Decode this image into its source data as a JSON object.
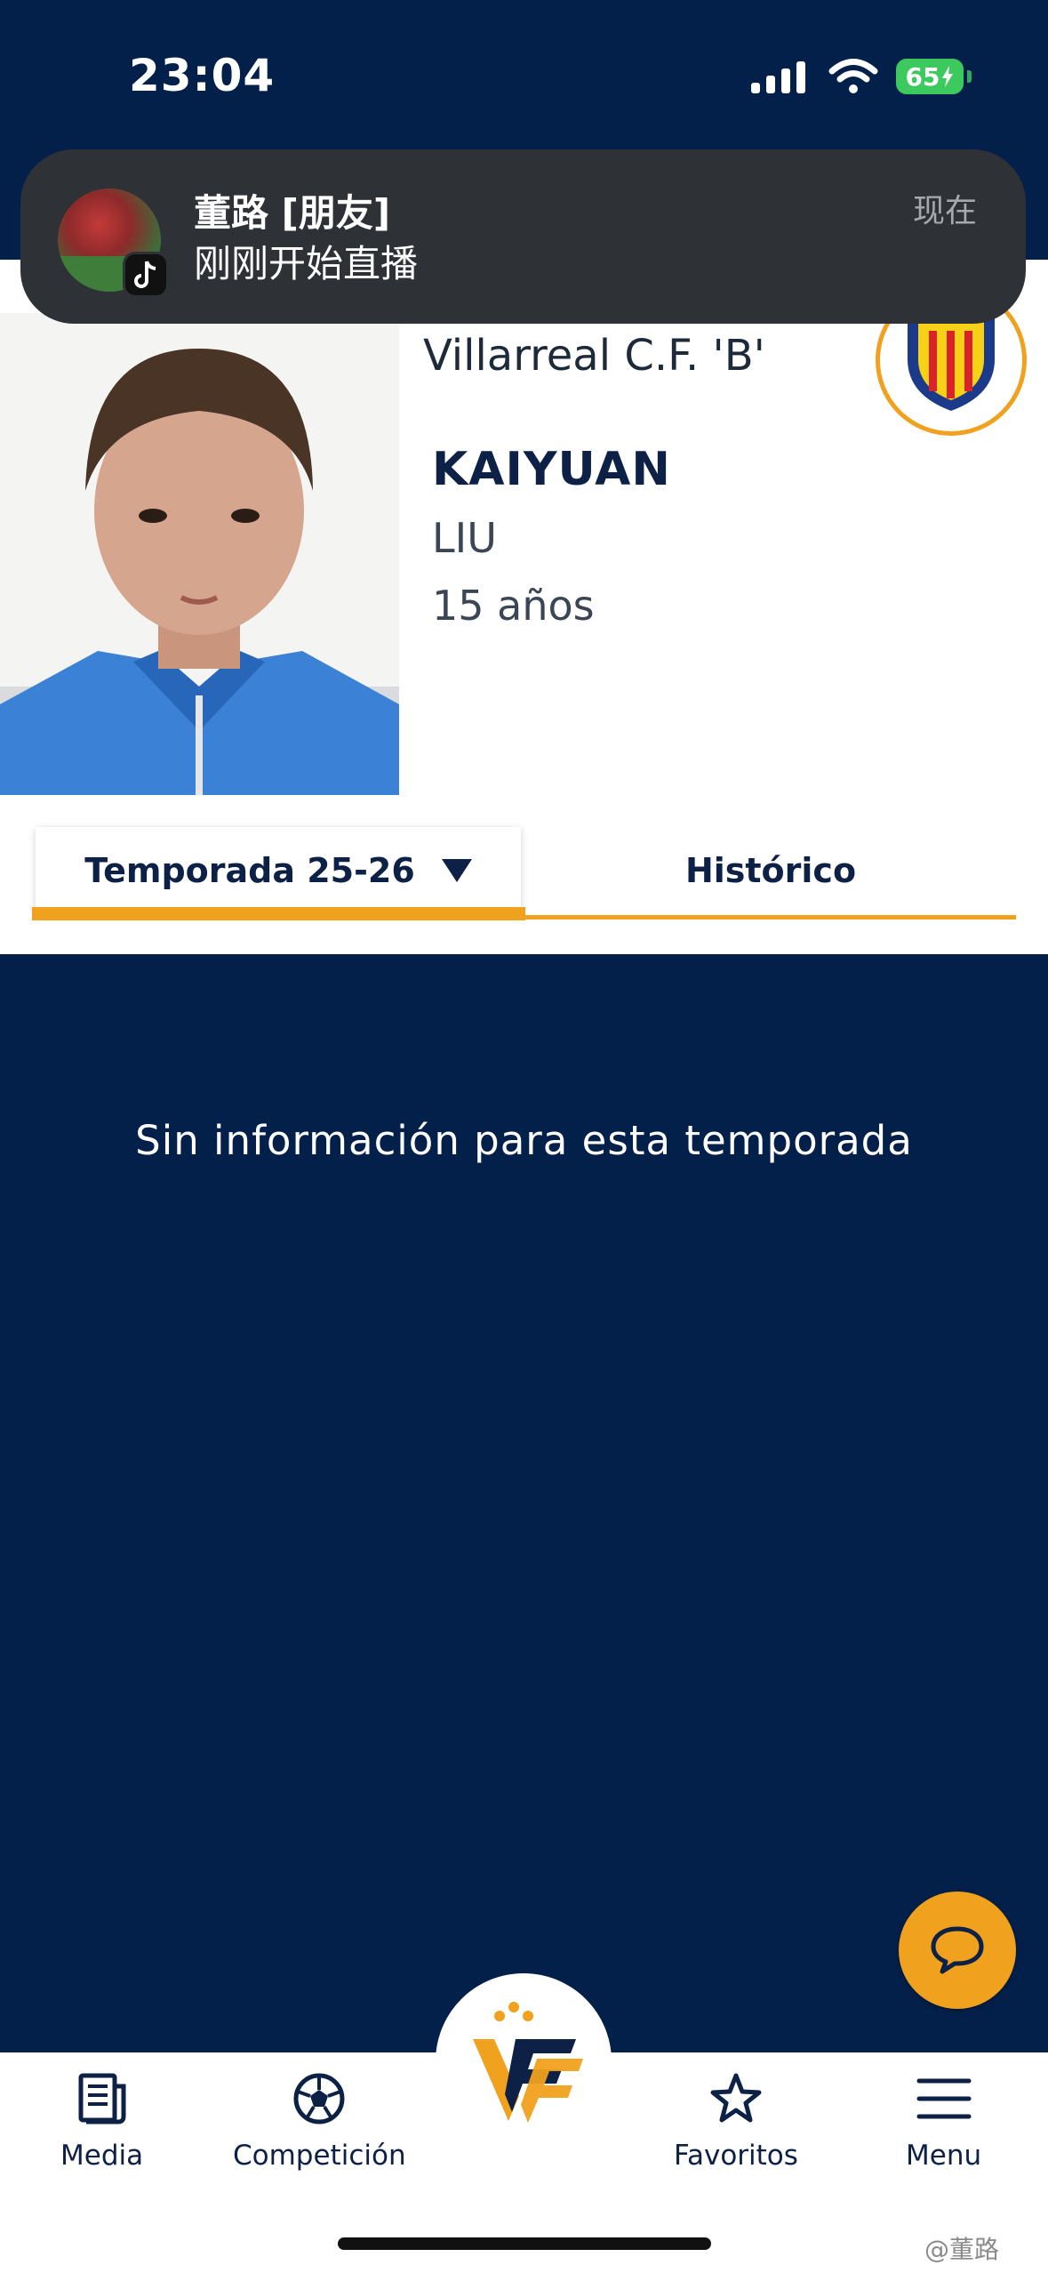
{
  "status_bar": {
    "time": "23:04",
    "battery": "65"
  },
  "notification": {
    "title": "董路 [朋友]",
    "body": "刚刚开始直播",
    "time": "现在"
  },
  "player": {
    "club": "Villarreal C.F. 'B'",
    "first_name": "KAIYUAN",
    "last_name": "LIU",
    "age": "15 años"
  },
  "tabs": {
    "season": "Temporada 25-26",
    "history": "Histórico"
  },
  "main": {
    "empty_message": "Sin información para esta temporada"
  },
  "bottom_nav": [
    {
      "label": "Media",
      "icon": "newspaper-icon"
    },
    {
      "label": "Competición",
      "icon": "football-icon"
    },
    {
      "label": "Favoritos",
      "icon": "star-icon"
    },
    {
      "label": "Menu",
      "icon": "hamburger-icon"
    }
  ],
  "watermark": "@董路",
  "colors": {
    "navy": "#03204b",
    "accent": "#f0a11d",
    "battery": "#3cc95d"
  }
}
